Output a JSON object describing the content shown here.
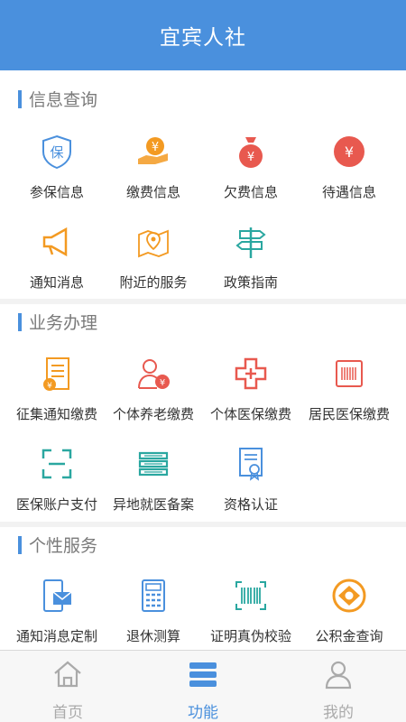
{
  "header": {
    "title": "宜宾人社"
  },
  "sections": [
    {
      "title": "信息查询",
      "items": [
        {
          "label": "参保信息",
          "icon": "insurance-shield-icon"
        },
        {
          "label": "缴费信息",
          "icon": "hand-yuan-icon"
        },
        {
          "label": "欠费信息",
          "icon": "money-bag-icon"
        },
        {
          "label": "待遇信息",
          "icon": "yuan-circle-icon"
        },
        {
          "label": "通知消息",
          "icon": "megaphone-icon"
        },
        {
          "label": "附近的服务",
          "icon": "map-pin-icon"
        },
        {
          "label": "政策指南",
          "icon": "signpost-icon"
        }
      ]
    },
    {
      "title": "业务办理",
      "items": [
        {
          "label": "征集通知缴费",
          "icon": "document-yuan-icon"
        },
        {
          "label": "个体养老缴费",
          "icon": "person-yuan-icon"
        },
        {
          "label": "个体医保缴费",
          "icon": "medical-cross-icon"
        },
        {
          "label": "居民医保缴费",
          "icon": "card-barcode-icon"
        },
        {
          "label": "医保账户支付",
          "icon": "scan-frame-icon"
        },
        {
          "label": "异地就医备案",
          "icon": "stacked-books-icon"
        },
        {
          "label": "资格认证",
          "icon": "certificate-icon"
        }
      ]
    },
    {
      "title": "个性服务",
      "items": [
        {
          "label": "通知消息定制",
          "icon": "phone-envelope-icon"
        },
        {
          "label": "退休测算",
          "icon": "calculator-icon"
        },
        {
          "label": "证明真伪校验",
          "icon": "barcode-scan-icon"
        },
        {
          "label": "公积金查询",
          "icon": "coin-icon"
        }
      ]
    }
  ],
  "tabbar": [
    {
      "label": "首页",
      "icon": "home-icon",
      "active": false
    },
    {
      "label": "功能",
      "icon": "menu-stack-icon",
      "active": true
    },
    {
      "label": "我的",
      "icon": "user-icon",
      "active": false
    }
  ],
  "colors": {
    "primary": "#4a90dd",
    "orange": "#f39a22",
    "red": "#e8594f",
    "teal": "#2aa7a0",
    "inactive": "#aaaaaa"
  }
}
